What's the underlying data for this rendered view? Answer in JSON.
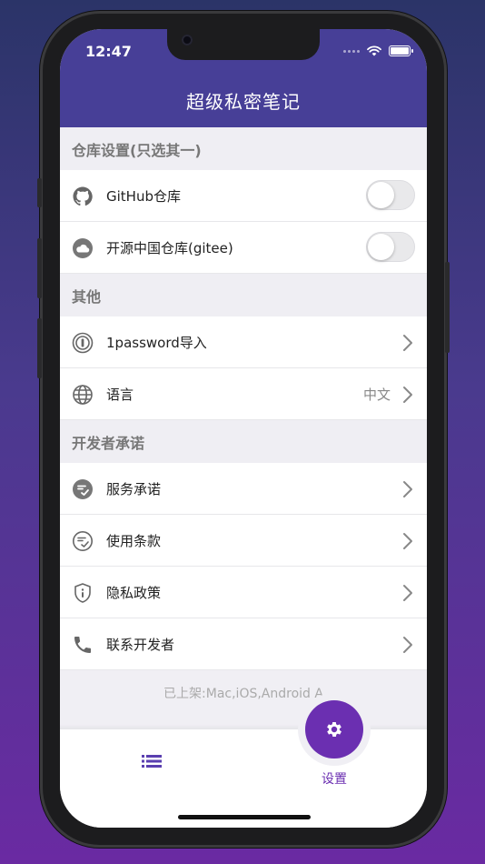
{
  "status": {
    "time": "12:47"
  },
  "header": {
    "title": "超级私密笔记"
  },
  "sections": {
    "repo": {
      "title": "仓库设置(只选其一)",
      "items": [
        {
          "label": "GitHub仓库",
          "enabled": false
        },
        {
          "label": "开源中国仓库(gitee)",
          "enabled": false
        }
      ]
    },
    "other": {
      "title": "其他",
      "items": [
        {
          "label": "1password导入"
        },
        {
          "label": "语言",
          "value": "中文"
        }
      ]
    },
    "developer": {
      "title": "开发者承诺",
      "items": [
        {
          "label": "服务承诺"
        },
        {
          "label": "使用条款"
        },
        {
          "label": "隐私政策"
        },
        {
          "label": "联系开发者"
        }
      ]
    }
  },
  "footer": {
    "platforms": "已上架:Mac,iOS,Android A"
  },
  "tabbar": {
    "settings_label": "设置"
  },
  "colors": {
    "header": "#473f97",
    "accent": "#6b2fb1",
    "background": "#f0eff4"
  },
  "icons": [
    "github-icon",
    "cloud-icon",
    "1password-icon",
    "globe-icon",
    "service-icon",
    "terms-icon",
    "privacy-shield-icon",
    "phone-icon",
    "chevron-right-icon",
    "list-icon",
    "gear-icon"
  ]
}
